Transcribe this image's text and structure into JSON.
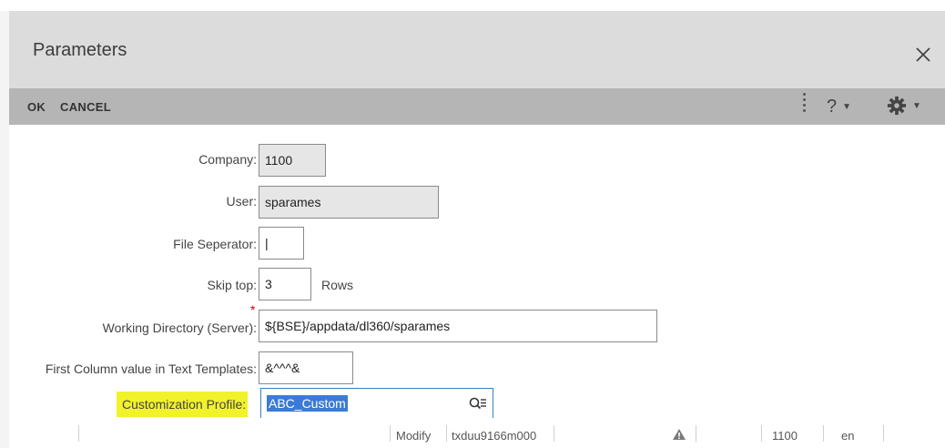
{
  "dialog": {
    "title": "Parameters"
  },
  "toolbar": {
    "ok_label": "OK",
    "cancel_label": "CANCEL",
    "help_label": "?"
  },
  "icons": {
    "close": "close-icon",
    "help": "help-icon",
    "settings": "gear-icon",
    "lookup": "lookup-icon",
    "warning": "warning-icon"
  },
  "form": {
    "company": {
      "label": "Company:",
      "value": "1100"
    },
    "user": {
      "label": "User:",
      "value": "sparames"
    },
    "file_separator": {
      "label": "File Seperator:",
      "value": "|"
    },
    "skip_top": {
      "label": "Skip top:",
      "value": "3",
      "unit": "Rows"
    },
    "working_directory": {
      "label": "Working Directory (Server):",
      "value": "${BSE}/appdata/dl360/sparames",
      "required_marker": "*"
    },
    "first_column_value": {
      "label": "First Column value in Text Templates:",
      "value": "&^^^&"
    },
    "customization_profile": {
      "label": "Customization Profile:",
      "value": "ABC_Custom"
    }
  },
  "statusbar": {
    "mode": "Modify",
    "session": "txduu9166m000",
    "company": "1100",
    "language": "en"
  },
  "colors": {
    "title_bar": "#dcdcdc",
    "toolbar": "#b5b5b5",
    "highlight": "#f2f22a",
    "selection": "#3b7bd6",
    "required": "#cc0000"
  }
}
